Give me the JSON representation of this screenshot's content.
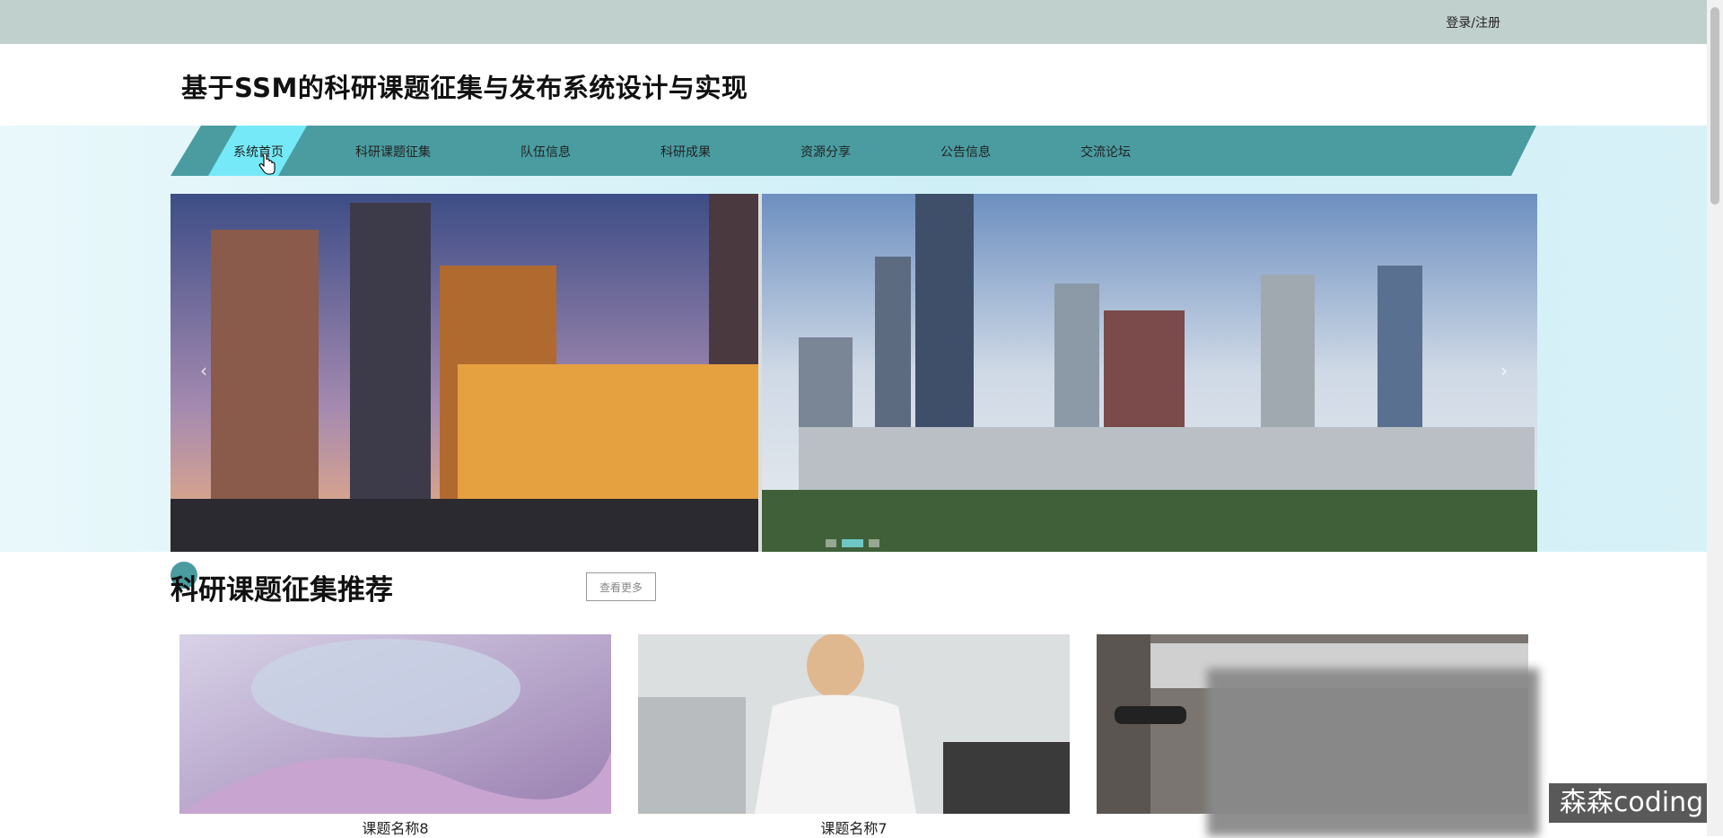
{
  "header": {
    "login_label": "登录/注册",
    "site_title": "基于SSM的科研课题征集与发布系统设计与实现"
  },
  "nav": {
    "items": [
      {
        "label": "系统首页",
        "active": true
      },
      {
        "label": "科研课题征集"
      },
      {
        "label": "队伍信息"
      },
      {
        "label": "科研成果"
      },
      {
        "label": "资源分享"
      },
      {
        "label": "公告信息"
      },
      {
        "label": "交流论坛"
      }
    ],
    "bar_color": "#4a9ca1",
    "active_color": "#75e9f7"
  },
  "carousel": {
    "prev_icon": "‹",
    "next_icon": "›",
    "slide_count": 3,
    "active_slide": 1
  },
  "section": {
    "title": "科研课题征集推荐",
    "more_label": "查看更多"
  },
  "cards": [
    {
      "name": "课题名称8"
    },
    {
      "name": "课题名称7"
    },
    {
      "name": ""
    }
  ],
  "watermark": "森森coding"
}
